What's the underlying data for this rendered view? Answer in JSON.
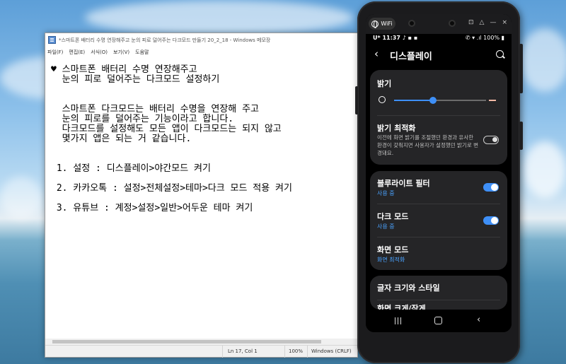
{
  "notepad": {
    "title": "*스마트폰 배터리 수명 연장해주고 눈의 피로 덜어주는 다크모드 만들기 20_2_18 - Windows 메모장",
    "menu": [
      "파일(F)",
      "편집(E)",
      "서식(O)",
      "보기(V)",
      "도움말"
    ],
    "lines": [
      "♥ 스마트폰 배터리 수명 연장해주고",
      "  눈의 피로 덜어주는 다크모드 설정하기",
      "",
      "",
      "  스마트폰 다크모드는 배터리 수명을 연장해 주고",
      "  눈의 피로를 덜어주는 기능이라고 합니다.",
      "  다크모드를 설정해도 모든 앱이 다크모드는 되지 않고",
      "  몇가지 앱은 되는 거 같습니다.",
      "",
      "",
      " 1. 설정 : 디스플레이>야간모드 켜기",
      "",
      " 2. 카카오톡 : 설정>전체설정>테마>다크 모드 적용 켜기",
      "",
      " 3. 유튜브 : 계정>설정>일반>어두운 테마 켜기"
    ],
    "status": {
      "position": "Ln 17, Col 1",
      "zoom": "100%",
      "encoding": "Windows (CRLF)"
    }
  },
  "phone": {
    "wifi_label": "WiFi",
    "status_left": "U* 11:37 ♪ ▪ ▪",
    "status_right": "✆ ▾ .ıl 100% ▮",
    "header_title": "디스플레이",
    "brightness": {
      "title": "밝기",
      "level": 0.42,
      "adaptive_title": "밝기 최적화",
      "adaptive_desc": "이전에 화면 밝기를 조절했던 환경과 유사한 환경이 갖춰지면 사용자가 설정했던 밝기로 변경돼요.",
      "adaptive_on": false
    },
    "blue_light": {
      "title": "블루라이트 필터",
      "status": "사용 중",
      "on": true
    },
    "dark_mode": {
      "title": "다크 모드",
      "status": "사용 중",
      "on": true
    },
    "screen_mode": {
      "title": "화면 모드",
      "status": "화면 최적화"
    },
    "font_style": {
      "title": "글자 크기와 스타일"
    },
    "next_item": {
      "title": "화면 크게/작게"
    }
  }
}
